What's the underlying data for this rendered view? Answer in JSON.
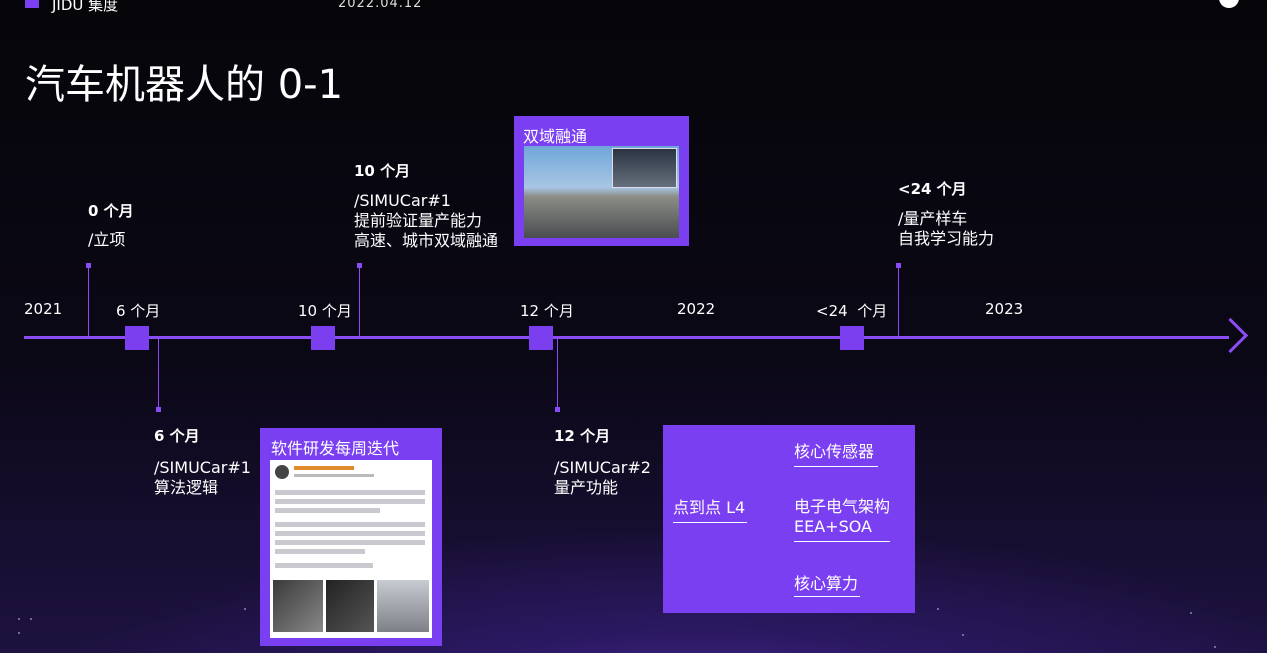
{
  "header": {
    "brand": "JIDU 集度",
    "date": "2022.04.12"
  },
  "title": "汽车机器人的 0-1",
  "axis_labels": [
    "2021",
    "6 个月",
    "10 个月",
    "12 个月",
    "2022",
    "<24  个月",
    "2023"
  ],
  "events": [
    {
      "month": "0 个月",
      "lines": [
        "/立项"
      ]
    },
    {
      "month": "10 个月",
      "lines": [
        "/SIMUCar#1",
        "提前验证量产能力",
        "高速、城市双域融通"
      ]
    },
    {
      "month": "<24 个月",
      "lines": [
        "/量产样车",
        "自我学习能力"
      ]
    },
    {
      "month": "6 个月",
      "lines": [
        "/SIMUCar#1",
        "算法逻辑"
      ]
    },
    {
      "month": "12 个月",
      "lines": [
        "/SIMUCar#2",
        "量产功能"
      ]
    }
  ],
  "cards": {
    "fusion": "双域融通",
    "weekly": "软件研发每周迭代"
  },
  "l4": {
    "label": "点到点 L4",
    "items": [
      "核心传感器",
      "电子电气架构",
      "EEA+SOA",
      "核心算力"
    ]
  },
  "colors": {
    "accent": "#7b3ff2",
    "axis": "#8b4cf5"
  }
}
